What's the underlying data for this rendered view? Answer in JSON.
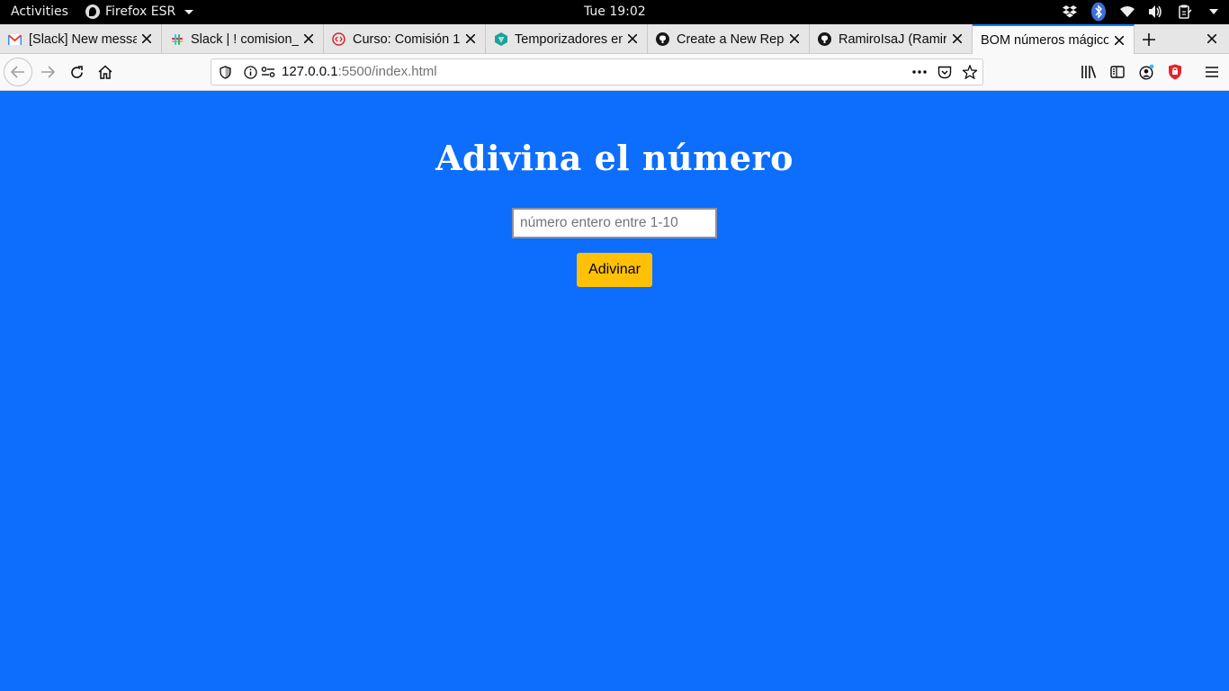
{
  "system_bar": {
    "activities": "Activities",
    "app_name": "Firefox ESR",
    "clock": "Tue 19:02",
    "tray_icons": [
      "dropbox-icon",
      "bluetooth-icon",
      "wifi-icon",
      "volume-icon",
      "clipboard-icon"
    ]
  },
  "browser": {
    "tabs": [
      {
        "title": "[Slack] New messages",
        "favicon": "gmail-icon",
        "active": false
      },
      {
        "title": "Slack | ! comision_",
        "favicon": "slack-icon",
        "active": false
      },
      {
        "title": "Curso: Comisión 1",
        "favicon": "course-icon",
        "active": false
      },
      {
        "title": "Temporizadores en",
        "favicon": "temporizadores-icon",
        "active": false
      },
      {
        "title": "Create a New Repository",
        "favicon": "github-icon",
        "active": false
      },
      {
        "title": "RamiroIsaJ (Ramiro",
        "favicon": "github-icon",
        "active": false
      },
      {
        "title": "BOM números mágicos",
        "favicon": "none",
        "active": true
      }
    ],
    "url": {
      "host": "127.0.0.1",
      "rest": ":5500/index.html"
    }
  },
  "page": {
    "heading": "Adivina el número",
    "input_placeholder": "número entero entre 1-10",
    "input_value": "",
    "button_label": "Adivinar",
    "background_color": "#0d6efd",
    "button_color": "#ffc107"
  }
}
